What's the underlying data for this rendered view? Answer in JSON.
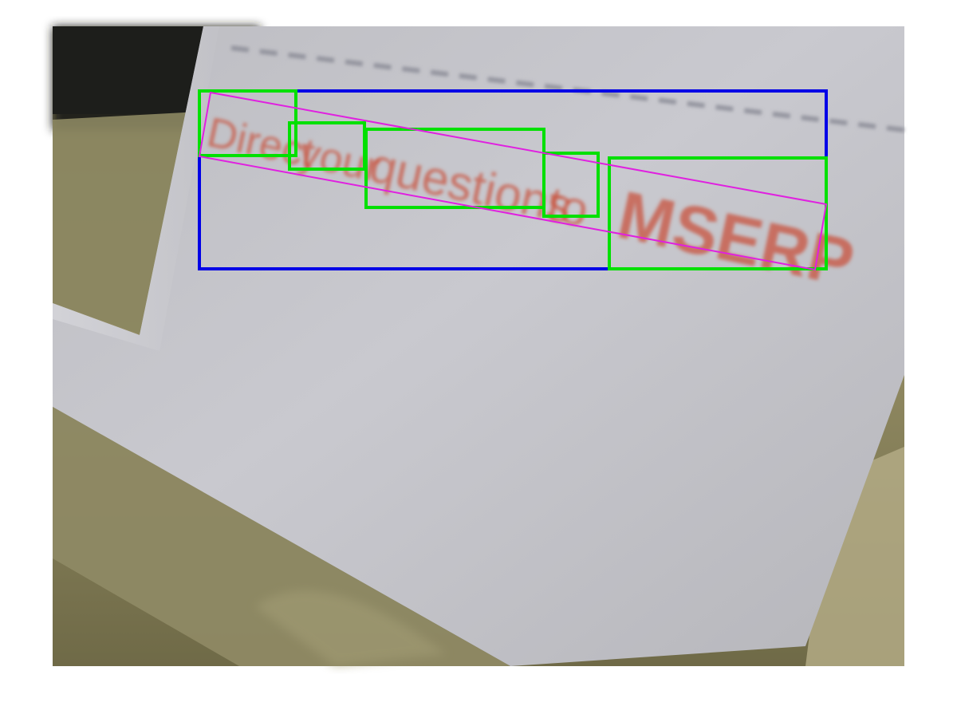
{
  "image": {
    "description_words": [
      "Direct",
      "your",
      "questions",
      "to",
      "MSERP"
    ],
    "text_line": "Direct your questions to MSERP"
  },
  "annotations": {
    "word_box_color": "#00e000",
    "line_box_color": "#0000e6",
    "rotated_box_color": "#e020e0"
  },
  "colors": {
    "background_dark": "#2b2b26",
    "table_wood": "#8f8a63",
    "paper": "#c8c8cf",
    "ink": "#c9533c"
  }
}
